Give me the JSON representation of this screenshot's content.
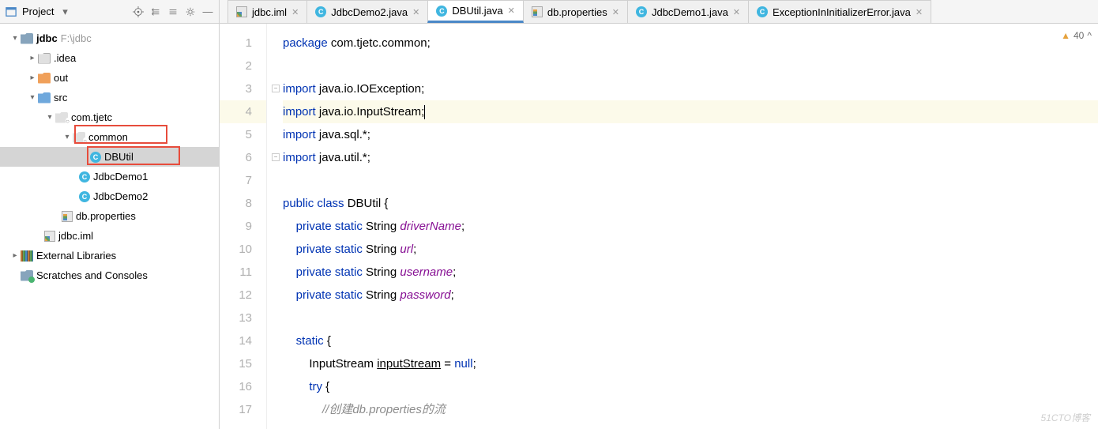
{
  "toolbar": {
    "label": "Project"
  },
  "tabs": [
    {
      "label": "jdbc.iml",
      "icon": "iml",
      "active": false
    },
    {
      "label": "JdbcDemo2.java",
      "icon": "class",
      "active": false
    },
    {
      "label": "DBUtil.java",
      "icon": "class",
      "active": true
    },
    {
      "label": "db.properties",
      "icon": "prop",
      "active": false
    },
    {
      "label": "JdbcDemo1.java",
      "icon": "class",
      "active": false
    },
    {
      "label": "ExceptionInInitializerError.java",
      "icon": "class",
      "active": false
    }
  ],
  "tree": {
    "root": {
      "name": "jdbc",
      "path": "F:\\jdbc"
    },
    "idea": ".idea",
    "out": "out",
    "src": "src",
    "pkg": "com.tjetc",
    "common": "common",
    "dbutil": "DBUtil",
    "jd1": "JdbcDemo1",
    "jd2": "JdbcDemo2",
    "dbprop": "db.properties",
    "iml": "jdbc.iml",
    "ext": "External Libraries",
    "scratch": "Scratches and Consoles"
  },
  "status": {
    "warnings": "40"
  },
  "code": {
    "l1_a": "package",
    "l1_b": " com.tjetc.common;",
    "l3_a": "import",
    "l3_b": " java.io.IOException;",
    "l4_a": "import",
    "l4_b": " java.io.InputStream;",
    "l5_a": "import",
    "l5_b": " java.sql.*;",
    "l6_a": "import",
    "l6_b": " java.util.*;",
    "l8_a": "public class ",
    "l8_b": "DBUtil {",
    "l9_a": "    private static ",
    "l9_b": "String ",
    "l9_c": "driverName",
    "l9_d": ";",
    "l10_a": "    private static ",
    "l10_b": "String ",
    "l10_c": "url",
    "l10_d": ";",
    "l11_a": "    private static ",
    "l11_b": "String ",
    "l11_c": "username",
    "l11_d": ";",
    "l12_a": "    private static ",
    "l12_b": "String ",
    "l12_c": "password",
    "l12_d": ";",
    "l14_a": "    static ",
    "l14_b": "{",
    "l15": "        InputStream inputStream = null;",
    "l15_u": "inputStream",
    "l16_a": "        try ",
    "l16_b": "{",
    "l17": "            //创建db.properties的流"
  },
  "line_numbers": [
    "1",
    "2",
    "3",
    "4",
    "5",
    "6",
    "7",
    "8",
    "9",
    "10",
    "11",
    "12",
    "13",
    "14",
    "15",
    "16",
    "17"
  ],
  "watermark": "51CTO博客"
}
